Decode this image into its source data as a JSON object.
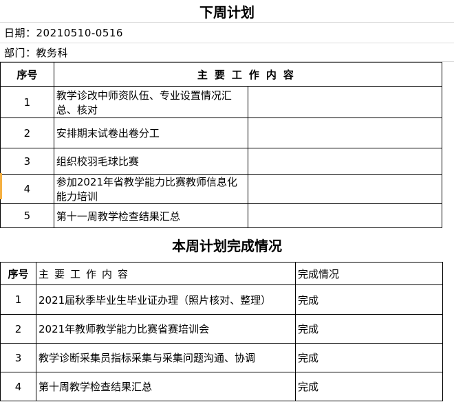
{
  "next_week": {
    "title": "下周计划",
    "date_label": "日期：",
    "date_value": "20210510-0516",
    "dept_label": "部门：",
    "dept_value": "教务科",
    "header_no": "序号",
    "header_work": "主要工作内容",
    "rows": [
      {
        "no": "1",
        "work": "教学诊改中师资队伍、专业设置情况汇总、核对",
        "status": ""
      },
      {
        "no": "2",
        "work": "安排期末试卷出卷分工",
        "status": ""
      },
      {
        "no": "3",
        "work": "组织校羽毛球比赛",
        "status": ""
      },
      {
        "no": "4",
        "work": "参加2021年省教学能力比赛教师信息化能力培训",
        "status": ""
      },
      {
        "no": "5",
        "work": "第十一周教学检查结果汇总",
        "status": ""
      }
    ]
  },
  "this_week": {
    "title": "本周计划完成情况",
    "header_no": "序号",
    "header_work": "主要工作内容",
    "header_status": "完成情况",
    "rows": [
      {
        "no": "1",
        "work": "2021届秋季毕业生毕业证办理（照片核对、整理）",
        "status": "完成"
      },
      {
        "no": "2",
        "work": "2021年教师教学能力比赛省赛培训会",
        "status": "完成"
      },
      {
        "no": "3",
        "work": "教学诊断采集员指标采集与采集问题沟通、协调",
        "status": "完成"
      },
      {
        "no": "4",
        "work": "第十周教学检查结果汇总",
        "status": "完成"
      }
    ]
  },
  "colors": {
    "gridline": "#dcdcdc",
    "border": "#000000",
    "row_marker": "#f5b041"
  }
}
